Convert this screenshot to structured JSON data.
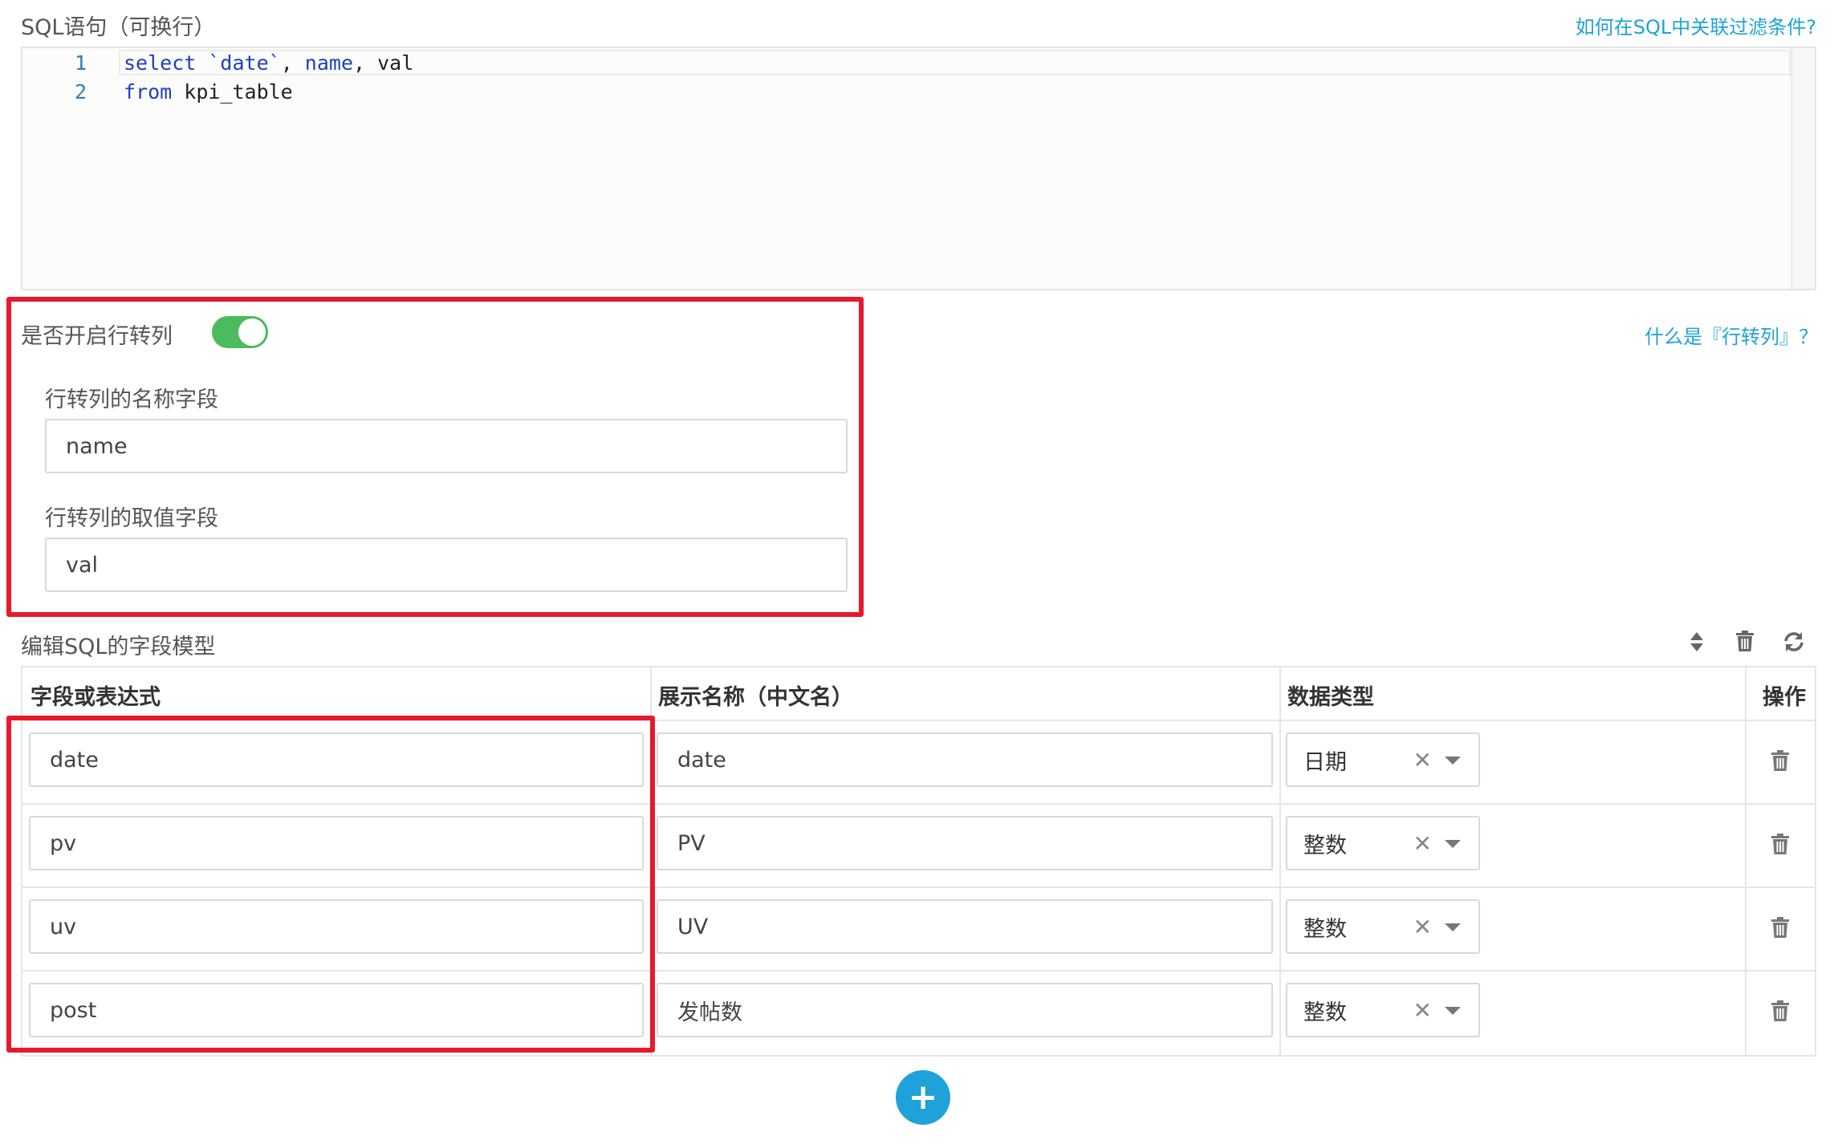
{
  "sql_section": {
    "label": "SQL语句（可换行）",
    "help_link": "如何在SQL中关联过滤条件?",
    "lines": [
      {
        "num": "1",
        "tokens": [
          {
            "t": "select",
            "c": "kw"
          },
          {
            "t": " ",
            "c": "plain"
          },
          {
            "t": "`date`",
            "c": "str"
          },
          {
            "t": ", ",
            "c": "plain"
          },
          {
            "t": "name",
            "c": "kw"
          },
          {
            "t": ", val",
            "c": "plain"
          }
        ]
      },
      {
        "num": "2",
        "tokens": [
          {
            "t": "from",
            "c": "kw"
          },
          {
            "t": " kpi_table",
            "c": "plain"
          }
        ]
      }
    ]
  },
  "pivot": {
    "toggle_label": "是否开启行转列",
    "toggle_on": true,
    "help_link": "什么是『行转列』？",
    "name_field_label": "行转列的名称字段",
    "name_field_value": "name",
    "value_field_label": "行转列的取值字段",
    "value_field_value": "val"
  },
  "field_model": {
    "title": "编辑SQL的字段模型",
    "toolbar_icons": [
      "sort-icon",
      "trash-icon",
      "refresh-icon"
    ],
    "columns": [
      "字段或表达式",
      "展示名称（中文名）",
      "数据类型",
      "操作"
    ],
    "rows": [
      {
        "field": "date",
        "display": "date",
        "type": "日期"
      },
      {
        "field": "pv",
        "display": "PV",
        "type": "整数"
      },
      {
        "field": "uv",
        "display": "UV",
        "type": "整数"
      },
      {
        "field": "post",
        "display": "发帖数",
        "type": "整数"
      }
    ],
    "clear_glyph": "✕",
    "add_glyph": "+"
  },
  "colors": {
    "accent": "#1fa2d9",
    "toggle_on": "#4cbb5e",
    "highlight": "#e8192d"
  }
}
